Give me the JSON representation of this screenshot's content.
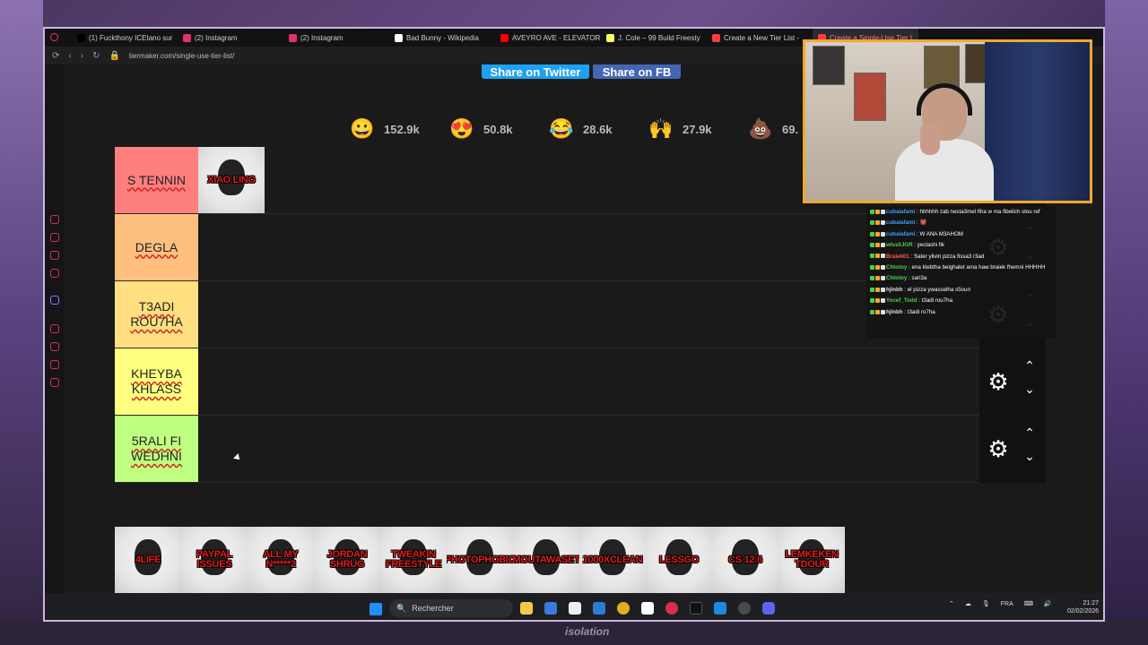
{
  "browser": {
    "tabs": [
      {
        "label": "(1) Fuckthony ICEtano sur",
        "color": "#000000"
      },
      {
        "label": "(2) Instagram",
        "color": "#e1306c"
      },
      {
        "label": "(2) Instagram",
        "color": "#e1306c"
      },
      {
        "label": "Bad Bunny - Wikipedia",
        "color": "#ffffff"
      },
      {
        "label": "AVEYRO AVE - ELEVATOR",
        "color": "#ff0000"
      },
      {
        "label": "J. Cole – 99 Build Freesty",
        "color": "#ffff64"
      },
      {
        "label": "Create a New Tier List -",
        "color": "#ff3b3b"
      },
      {
        "label": "Create a Single-Use Tier L",
        "color": "#ff3b3b"
      }
    ],
    "url": "tiermaker.com/single-use-tier-list/"
  },
  "share": {
    "twitter": "Share on Twitter",
    "facebook": "Share on FB"
  },
  "reactions": [
    {
      "emoji": "😀",
      "count": "152.9k"
    },
    {
      "emoji": "😍",
      "count": "50.8k"
    },
    {
      "emoji": "😂",
      "count": "28.6k"
    },
    {
      "emoji": "🙌",
      "count": "27.9k"
    },
    {
      "emoji": "💩",
      "count": "69."
    }
  ],
  "tiers": [
    {
      "label": "S TENNIN",
      "color": "#ff7f7f",
      "items": [
        "XIAO LING"
      ]
    },
    {
      "label": "DEGLA",
      "color": "#ffbf7f",
      "items": []
    },
    {
      "label": "T3ADI ROU7HA",
      "color": "#ffdf7f",
      "items": []
    },
    {
      "label": "KHEYBA KHLASS",
      "color": "#ffff7f",
      "items": []
    },
    {
      "label": "5RALI FI WEDHNI",
      "color": "#bfff7f",
      "items": []
    }
  ],
  "pool": [
    "4LIFE",
    "PAYPAL ISSUES",
    "ALL MY N*****2",
    "JORDAN SHRUG",
    "TWEAKIN FREESTYLE",
    "PHOTOPHOBIC",
    "MOUTAWASET",
    "1000XCLEAN",
    "LESSGO",
    "CS 12.6",
    "LEMKEKEN TDOUR"
  ],
  "chat": [
    {
      "user": "cubalafami",
      "color": "#3aa0ff",
      "msg": " : hhhhhh zab nesta3mel fiha w ma fibelich stou ref"
    },
    {
      "user": "cubalafami",
      "color": "#3aa0ff",
      "msg": " : 👹"
    },
    {
      "user": "cubalafami",
      "color": "#3aa0ff",
      "msg": " : W ANA M3AHOM"
    },
    {
      "user": "wlss0JGR",
      "color": "#4fd04f",
      "msg": " : yeclashi fik"
    },
    {
      "user": "Braiek01",
      "color": "#ff5a5a",
      "msg": " : Sater yliviri pizza fissa3 r3ad"
    },
    {
      "user": "Chtotoy",
      "color": "#4fd04f",
      "msg": " : ena ktebtha beighalet ama haw braiek fhemni HHHHH"
    },
    {
      "user": "Chtotoy",
      "color": "#4fd04f",
      "msg": " : sari3a"
    },
    {
      "user": "hjlnbh",
      "color": "#e0e0e0",
      "msg": " : el pizza ywasselha s5oun"
    },
    {
      "user": "Yocef_Todd",
      "color": "#4fd04f",
      "msg": " : t3adi rou7ha"
    },
    {
      "user": "hjlnbh",
      "color": "#e0e0e0",
      "msg": " : t3adi ro7ha"
    }
  ],
  "taskbar": {
    "search_placeholder": "Rechercher",
    "lang": "FRA",
    "time": "21:27",
    "date": "02/02/2026"
  },
  "stream_overlay": {
    "bottom_logo": "isolation"
  }
}
